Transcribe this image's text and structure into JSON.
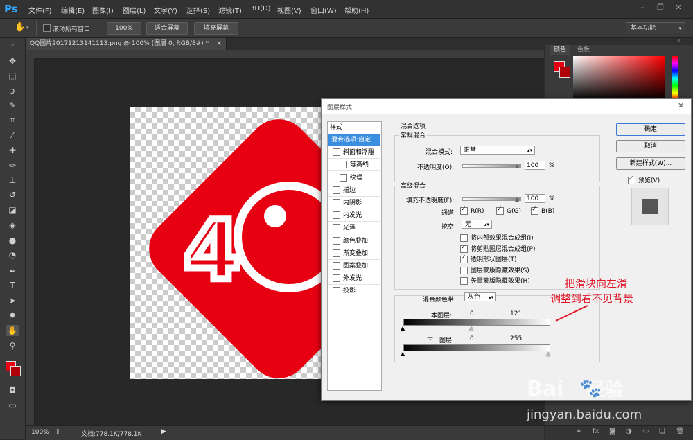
{
  "app": {
    "logo": "Ps"
  },
  "menu": [
    "文件(F)",
    "编辑(E)",
    "图像(I)",
    "图层(L)",
    "文字(Y)",
    "选择(S)",
    "滤镜(T)",
    "3D(D)",
    "视图(V)",
    "窗口(W)",
    "帮助(H)"
  ],
  "options": {
    "scroll_all": "滚动所有窗口",
    "zoom_100": "100%",
    "fit_screen": "适合屏幕",
    "fill_screen": "填充屏幕",
    "workspace": "基本功能"
  },
  "document": {
    "tab_title": "QQ图片20171213141113.png @ 100% (图层 0, RGB/8#) *",
    "tab_close": "×"
  },
  "status": {
    "zoom": "100%",
    "doc_info": "文档:778.1K/778.1K"
  },
  "panel": {
    "tab_color": "颜色",
    "tab_swatches": "色板"
  },
  "artwork": {
    "digit": "4",
    "brand_red": "#e60012"
  },
  "dialog": {
    "title": "图层样式",
    "styles_header": "样式",
    "styles": [
      {
        "label": "混合选项:自定",
        "check": false,
        "selected": true,
        "indent": false
      },
      {
        "label": "斜面和浮雕",
        "check": true,
        "checked": false,
        "indent": false
      },
      {
        "label": "等高线",
        "check": true,
        "checked": false,
        "indent": true
      },
      {
        "label": "纹理",
        "check": true,
        "checked": false,
        "indent": true
      },
      {
        "label": "描边",
        "check": true,
        "checked": false,
        "indent": false
      },
      {
        "label": "内阴影",
        "check": true,
        "checked": false,
        "indent": false
      },
      {
        "label": "内发光",
        "check": true,
        "checked": false,
        "indent": false
      },
      {
        "label": "光泽",
        "check": true,
        "checked": false,
        "indent": false
      },
      {
        "label": "颜色叠加",
        "check": true,
        "checked": false,
        "indent": false
      },
      {
        "label": "渐变叠加",
        "check": true,
        "checked": false,
        "indent": false
      },
      {
        "label": "图案叠加",
        "check": true,
        "checked": false,
        "indent": false
      },
      {
        "label": "外发光",
        "check": true,
        "checked": false,
        "indent": false
      },
      {
        "label": "投影",
        "check": true,
        "checked": false,
        "indent": false
      }
    ],
    "blend_options_title": "混合选项",
    "general_blend_title": "常规混合",
    "blend_mode_label": "混合模式:",
    "blend_mode_value": "正常",
    "opacity_label": "不透明度(O):",
    "opacity_value": "100",
    "percent": "%",
    "advanced_blend_title": "高级混合",
    "fill_opacity_label": "填充不透明度(F):",
    "fill_opacity_value": "100",
    "channels_label": "通道:",
    "channels": [
      {
        "label": "R(R)",
        "checked": true
      },
      {
        "label": "G(G)",
        "checked": true
      },
      {
        "label": "B(B)",
        "checked": true
      }
    ],
    "knockout_label": "挖空:",
    "knockout_value": "无",
    "adv_options": [
      {
        "label": "将内部效果混合成组(I)",
        "checked": false
      },
      {
        "label": "将剪贴图层混合成组(P)",
        "checked": true
      },
      {
        "label": "透明形状图层(T)",
        "checked": true
      },
      {
        "label": "图层蒙版隐藏效果(S)",
        "checked": false
      },
      {
        "label": "矢量蒙版隐藏效果(H)",
        "checked": false
      }
    ],
    "blend_if_label": "混合颜色带:",
    "blend_if_value": "灰色",
    "this_layer_label": "本图层:",
    "this_layer_black": "0",
    "this_layer_white": "121",
    "underlying_label": "下一图层:",
    "underlying_black": "0",
    "underlying_white": "255",
    "ok": "确定",
    "cancel": "取消",
    "new_style": "新建样式(W)...",
    "preview_label": "预览(V)",
    "preview_checked": true
  },
  "annotation": {
    "line1": "把滑块向左滑",
    "line2": "调整到看不见背景",
    "color": "#e0182a"
  },
  "watermark": {
    "brand": "Bai",
    "brand2": "经验",
    "url": "jingyan.baidu.com"
  }
}
